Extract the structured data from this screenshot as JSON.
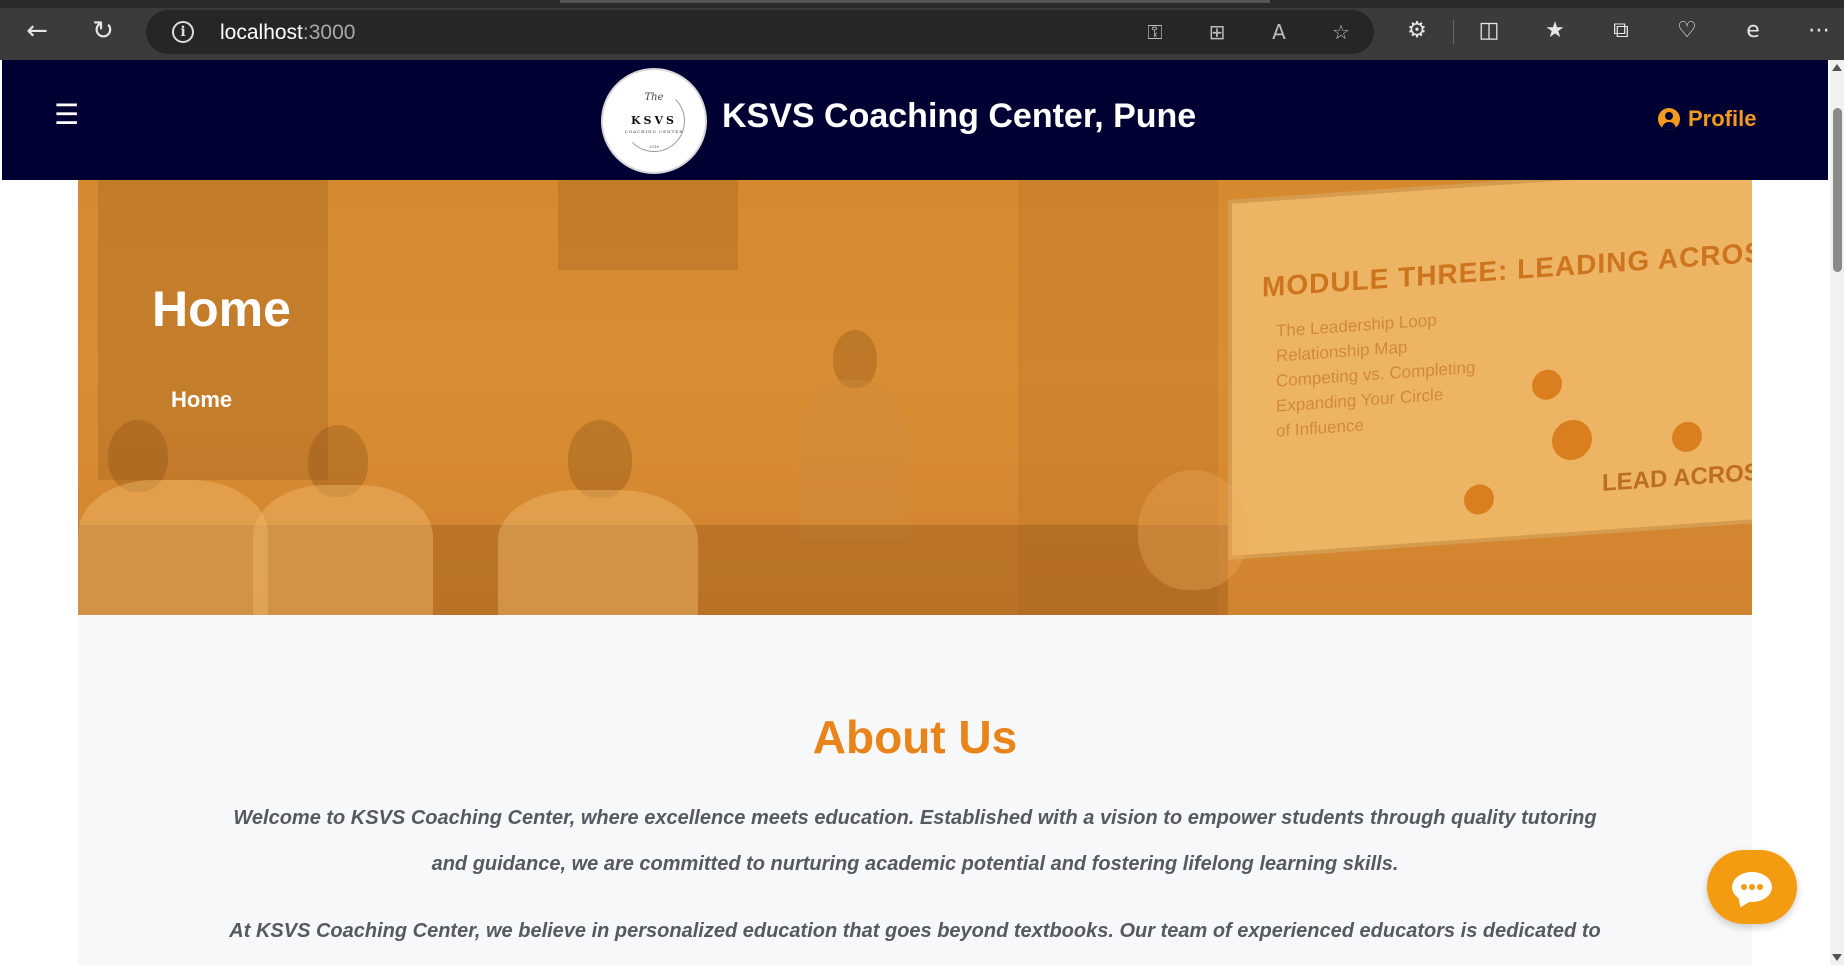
{
  "browser": {
    "url_host": "localhost",
    "url_port": ":3000",
    "icons": [
      "back-icon",
      "refresh-icon",
      "info-icon",
      "key-icon",
      "app-available-icon",
      "read-aloud-icon",
      "favorite-star-icon",
      "extensions-icon",
      "split-screen-icon",
      "favorites-icon",
      "collections-icon",
      "browser-essentials-icon",
      "ie-mode-icon",
      "more-icon"
    ]
  },
  "header": {
    "title": "KSVS Coaching Center, Pune",
    "profile_label": "Profile",
    "logo": {
      "line1": "The",
      "line2": "KSVS",
      "line3": "COACHING CENTER",
      "line4": "· 2016 ·"
    }
  },
  "hero": {
    "title": "Home",
    "breadcrumb": "Home",
    "slide_heading": "MODULE THREE: LEADING ACROSS",
    "slide_bullets": [
      "The Leadership Loop",
      "Relationship Map",
      "Competing vs. Completing",
      "Expanding Your Circle",
      "of Influence"
    ],
    "slide_lead": "LEAD ACROSS"
  },
  "about": {
    "title": "About Us",
    "paragraph1": "Welcome to KSVS Coaching Center, where excellence meets education. Established with a vision to empower students through quality tutoring and guidance, we are committed to nurturing academic potential and fostering lifelong learning skills.",
    "paragraph2": "At KSVS Coaching Center, we believe in personalized education that goes beyond textbooks. Our team of experienced educators is dedicated to"
  },
  "colors": {
    "header_bg": "#000033",
    "accent_orange": "#e8841a",
    "profile_orange": "#f29a20",
    "chat_orange": "#f39c12"
  }
}
